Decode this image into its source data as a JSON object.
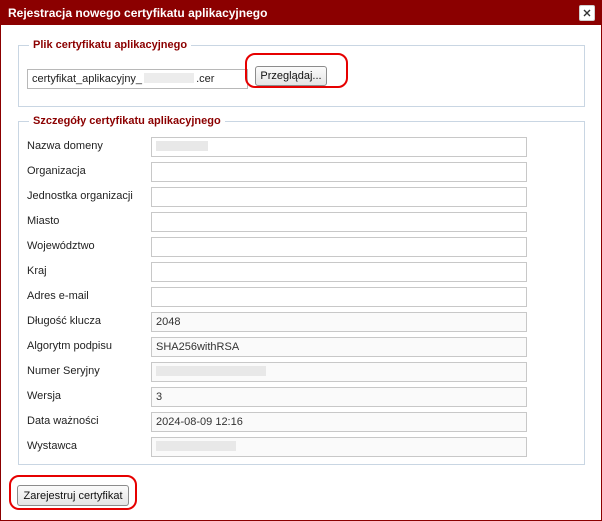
{
  "dialog": {
    "title": "Rejestracja nowego certyfikatu aplikacyjnego",
    "close_glyph": "✕"
  },
  "file_section": {
    "legend": "Plik certyfikatu aplikacyjnego",
    "file_prefix": "certyfikat_aplikacyjny_",
    "file_suffix": ".cer",
    "browse_label": "Przeglądaj..."
  },
  "details_section": {
    "legend": "Szczegóły certyfikatu aplikacyjnego",
    "rows": [
      {
        "label": "Nazwa domeny",
        "value": "",
        "redacted": true
      },
      {
        "label": "Organizacja",
        "value": ""
      },
      {
        "label": "Jednostka organizacji",
        "value": ""
      },
      {
        "label": "Miasto",
        "value": ""
      },
      {
        "label": "Województwo",
        "value": ""
      },
      {
        "label": "Kraj",
        "value": ""
      },
      {
        "label": "Adres e-mail",
        "value": ""
      },
      {
        "label": "Długość klucza",
        "value": "2048"
      },
      {
        "label": "Algorytm podpisu",
        "value": "SHA256withRSA"
      },
      {
        "label": "Numer Seryjny",
        "value": "",
        "redacted": true
      },
      {
        "label": "Wersja",
        "value": "3"
      },
      {
        "label": "Data ważności",
        "value": "2024-08-09 12:16"
      },
      {
        "label": "Wystawca",
        "value": "",
        "redacted": true
      }
    ]
  },
  "footer": {
    "register_label": "Zarejestruj certyfikat"
  },
  "colors": {
    "titlebar": "#8b0000",
    "legend": "#8b0000",
    "highlight": "#e60000"
  }
}
